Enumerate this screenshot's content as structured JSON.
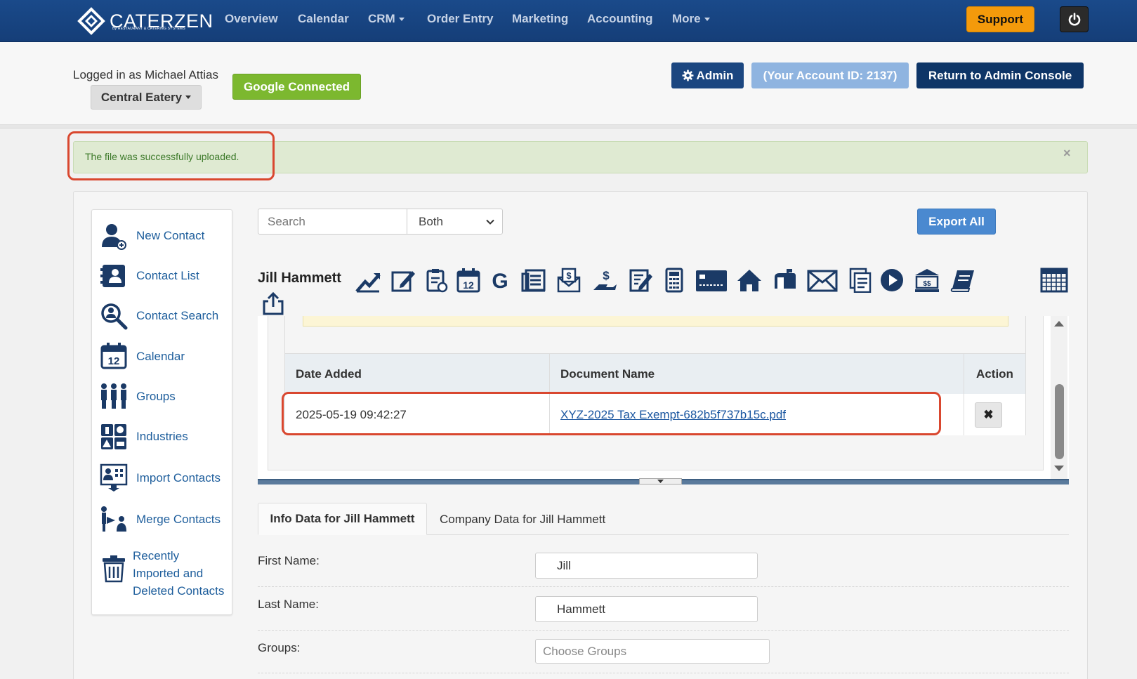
{
  "app": {
    "brand": "CATERZEN",
    "brand_sub": "By RESTAURANT & CATERING SYSTEMS"
  },
  "nav": {
    "items": [
      "Overview",
      "Calendar",
      "CRM",
      "Order Entry",
      "Marketing",
      "Accounting",
      "More"
    ],
    "support": "Support"
  },
  "header": {
    "logged_in": "Logged in as Michael Attias",
    "location": "Central Eatery",
    "google": "Google Connected",
    "admin": "Admin",
    "account_id": "(Your Account ID: 2137)",
    "return": "Return to Admin Console"
  },
  "alert": {
    "message": "The file was successfully uploaded.",
    "close": "×"
  },
  "sidebar": {
    "items": [
      {
        "label": "New Contact",
        "icon": "new-contact-icon"
      },
      {
        "label": "Contact List",
        "icon": "contact-list-icon"
      },
      {
        "label": "Contact Search",
        "icon": "contact-search-icon"
      },
      {
        "label": "Calendar",
        "icon": "calendar-icon"
      },
      {
        "label": "Groups",
        "icon": "groups-icon"
      },
      {
        "label": "Industries",
        "icon": "industries-icon"
      },
      {
        "label": "Import Contacts",
        "icon": "import-contacts-icon"
      },
      {
        "label": "Merge Contacts",
        "icon": "merge-contacts-icon"
      },
      {
        "label": "Recently Imported and Deleted Contacts",
        "line1": "Recently",
        "line2": "Imported and",
        "line3": "Deleted Contacts",
        "icon": "trash-icon"
      }
    ]
  },
  "search": {
    "placeholder": "Search",
    "filter": "Both",
    "export": "Export All"
  },
  "contact": {
    "name": "Jill Hammett"
  },
  "documents": {
    "columns": [
      "Date Added",
      "Document Name",
      "Action"
    ],
    "rows": [
      {
        "date": "2025-05-19 09:42:27",
        "name": "XYZ-2025 Tax Exempt-682b5f737b15c.pdf",
        "action": "✖"
      }
    ]
  },
  "tabs": [
    "Info Data for Jill Hammett",
    "Company Data for Jill Hammett"
  ],
  "form": {
    "first_name_label": "First Name:",
    "first_name": "Jill",
    "last_name_label": "Last Name:",
    "last_name": "Hammett",
    "groups_label": "Groups:",
    "groups_placeholder": "Choose Groups"
  },
  "colors": {
    "navbar": "#1a4a8a",
    "support": "#f49a0b",
    "google": "#7cb82f",
    "admin": "#1b4680",
    "highlight": "#d9472f",
    "link": "#1e5e9c"
  }
}
